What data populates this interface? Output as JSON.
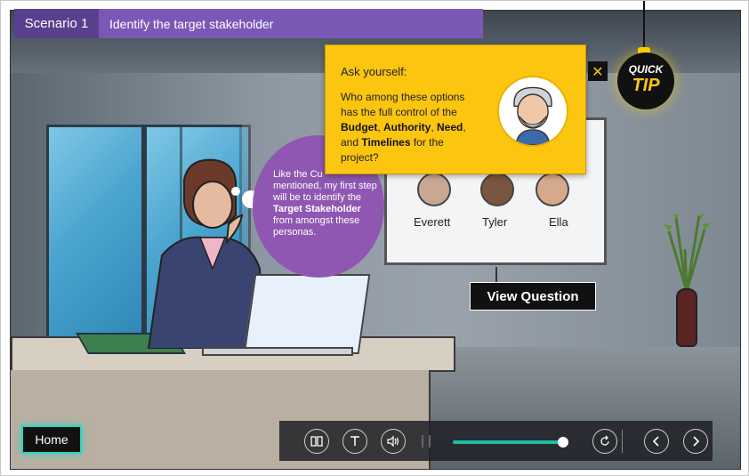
{
  "header": {
    "scenario_label": "Scenario 1",
    "title": "Identify the target stakeholder"
  },
  "thought_bubble": {
    "line_1": "Like the Cu",
    "line_2": "mentioned, my first step",
    "line_3": "will be to identify the",
    "bold": "Target Stakeholder",
    "line_4": "from amongst these",
    "line_5": "personas."
  },
  "tip": {
    "ask": "Ask yourself:",
    "q_part1": "Who among these options has the full control of the ",
    "b1": "Budget",
    "sep1": ", ",
    "b2": "Authority",
    "sep2": ", ",
    "b3": "Need",
    "sep3": ", and ",
    "b4": "Timelines",
    "q_part2": " for the project?"
  },
  "quick_tip": {
    "word1": "QUICK",
    "word2": "TIP"
  },
  "whiteboard": {
    "people": [
      "Everett",
      "Tyler",
      "Ella"
    ]
  },
  "buttons": {
    "view_question": "View Question",
    "home": "Home"
  },
  "close": {
    "glyph": "✕"
  },
  "player": {
    "progress": 0.95
  },
  "colors": {
    "header_dark": "#5a3f8e",
    "header_light": "#7a58b5",
    "tip_yellow": "#fcc510",
    "thought_purple": "#8f57b2",
    "progress_teal": "#1fbfa3",
    "home_glow": "#2fd3c0"
  }
}
